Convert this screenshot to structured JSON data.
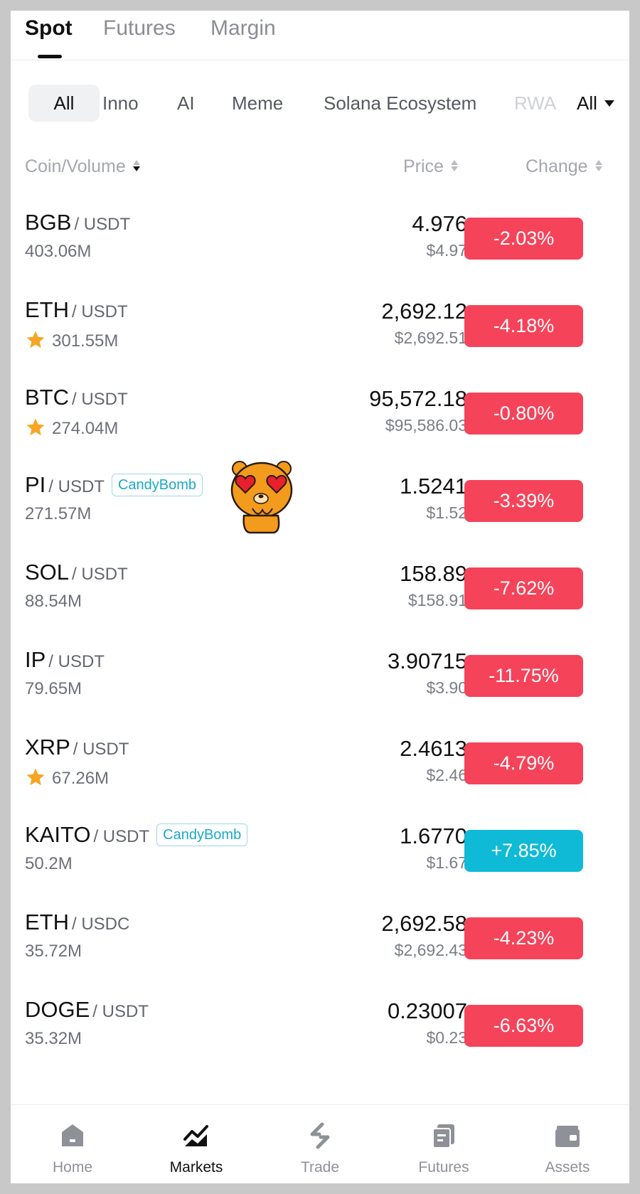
{
  "top_tabs": [
    "Spot",
    "Futures",
    "Margin"
  ],
  "categories": [
    "All",
    "Inno",
    "AI",
    "Meme",
    "Solana Ecosystem",
    "RWA"
  ],
  "filter": {
    "label": "All"
  },
  "columns": {
    "coin": "Coin/Volume",
    "price": "Price",
    "change": "Change"
  },
  "colors": {
    "down": "#f5435a",
    "up": "#0fbad7",
    "star": "#f6a623",
    "badge": "#19a9c7"
  },
  "rows": [
    {
      "base": "BGB",
      "quote": "/ USDT",
      "volume": "403.06M",
      "price": "4.976",
      "fiat": "$4.97",
      "change": "-2.03%",
      "direction": "down"
    },
    {
      "base": "ETH",
      "quote": "/ USDT",
      "volume": "301.55M",
      "price": "2,692.12",
      "fiat": "$2,692.51",
      "change": "-4.18%",
      "direction": "down",
      "favorite": true
    },
    {
      "base": "BTC",
      "quote": "/ USDT",
      "volume": "274.04M",
      "price": "95,572.18",
      "fiat": "$95,586.03",
      "change": "-0.80%",
      "direction": "down",
      "favorite": true
    },
    {
      "base": "PI",
      "quote": "/ USDT",
      "badge": "CandyBomb",
      "volume": "271.57M",
      "price": "1.5241",
      "fiat": "$1.52",
      "change": "-3.39%",
      "direction": "down"
    },
    {
      "base": "SOL",
      "quote": "/ USDT",
      "volume": "88.54M",
      "price": "158.89",
      "fiat": "$158.91",
      "change": "-7.62%",
      "direction": "down"
    },
    {
      "base": "IP",
      "quote": "/ USDT",
      "volume": "79.65M",
      "price": "3.90715",
      "fiat": "$3.90",
      "change": "-11.75%",
      "direction": "down"
    },
    {
      "base": "XRP",
      "quote": "/ USDT",
      "volume": "67.26M",
      "price": "2.4613",
      "fiat": "$2.46",
      "change": "-4.79%",
      "direction": "down",
      "favorite": true
    },
    {
      "base": "KAITO",
      "quote": "/ USDT",
      "badge": "CandyBomb",
      "volume": "50.2M",
      "price": "1.6770",
      "fiat": "$1.67",
      "change": "+7.85%",
      "direction": "up"
    },
    {
      "base": "ETH",
      "quote": "/ USDC",
      "volume": "35.72M",
      "price": "2,692.58",
      "fiat": "$2,692.43",
      "change": "-4.23%",
      "direction": "down"
    },
    {
      "base": "DOGE",
      "quote": "/ USDT",
      "volume": "35.32M",
      "price": "0.23007",
      "fiat": "$0.23",
      "change": "-6.63%",
      "direction": "down"
    }
  ],
  "bottom_nav": [
    {
      "label": "Home",
      "icon": "home-icon"
    },
    {
      "label": "Markets",
      "icon": "markets-chart-icon",
      "active": true
    },
    {
      "label": "Trade",
      "icon": "trade-exchange-icon"
    },
    {
      "label": "Futures",
      "icon": "futures-icon"
    },
    {
      "label": "Assets",
      "icon": "wallet-icon"
    }
  ]
}
